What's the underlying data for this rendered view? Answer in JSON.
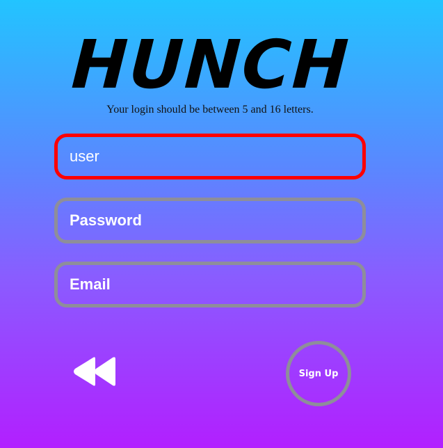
{
  "app": {
    "logo_text": "HUNCH"
  },
  "form": {
    "hint": "Your login should be between 5 and 16 letters.",
    "login": {
      "value": "user",
      "state": "invalid"
    },
    "password": {
      "placeholder": "Password"
    },
    "email": {
      "placeholder": "Email"
    },
    "signup_label": "Sign Up"
  },
  "icons": {
    "back": "rewind-icon"
  },
  "colors": {
    "gradient_top": "#22c4ff",
    "gradient_bottom": "#b21fff",
    "error_border": "#ff0000",
    "field_border": "#8e8e9a",
    "text": "#ffffff"
  }
}
